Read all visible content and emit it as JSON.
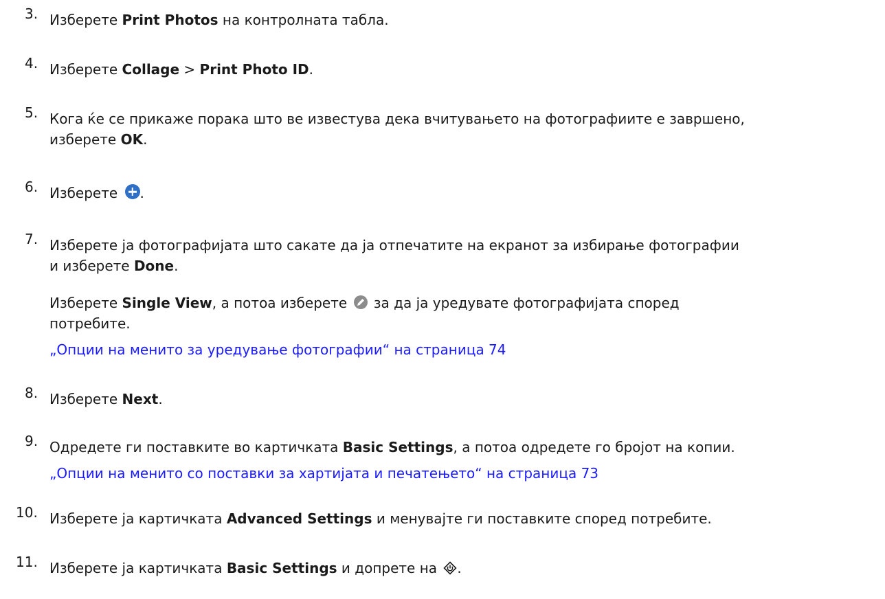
{
  "steps": [
    {
      "num": "3.",
      "pre": "Изберете ",
      "b1": "Print Photos",
      "post": " на контролната табла."
    },
    {
      "num": "4.",
      "pre": "Изберете ",
      "b1": "Collage",
      "mid": " > ",
      "b2": "Print Photo ID",
      "post": "."
    },
    {
      "num": "5.",
      "line1": "Кога ќе се прикаже порака што ве известува дека вчитувањето на фотографиите е завршено,",
      "pre2": "изберете ",
      "b1": "OK",
      "post": "."
    },
    {
      "num": "6.",
      "pre": "Изберете ",
      "post": ".",
      "icon": "add-circle-icon"
    },
    {
      "num": "7.",
      "line1": "Изберете ја фотографијата што сакате да ја отпечатите на екранот за избирање фотографии",
      "pre2": "и изберете ",
      "b1": "Done",
      "post": ".",
      "note_pre": "Изберете ",
      "note_b": "Single View",
      "note_mid": ", а потоа изберете ",
      "note_icon": "edit-pencil-icon",
      "note_post": " за да ја уредувате фотографијата според",
      "note_line2": "потребите.",
      "link": "„Опции на менито за уредување фотографии“ на страница 74"
    },
    {
      "num": "8.",
      "pre": "Изберете ",
      "b1": "Next",
      "post": "."
    },
    {
      "num": "9.",
      "pre": "Одредете ги поставките во картичката ",
      "b1": "Basic Settings",
      "post": ", а потоа одредете го бројот на копии.",
      "link": "„Опции на менито со поставки за хартијата и печатењето“ на страница 73"
    },
    {
      "num": "10.",
      "pre": "Изберете ја картичката ",
      "b1": "Advanced Settings",
      "post": " и менувајте ги поставките според потребите."
    },
    {
      "num": "11.",
      "pre": "Изберете ја картичката ",
      "b1": "Basic Settings",
      "post": " и допрете на ",
      "post2": ".",
      "icon": "start-button-icon"
    }
  ],
  "colors": {
    "link": "#1a1aff",
    "plus_icon": "#2f6fc5",
    "pencil_icon": "#8c8c8c"
  }
}
